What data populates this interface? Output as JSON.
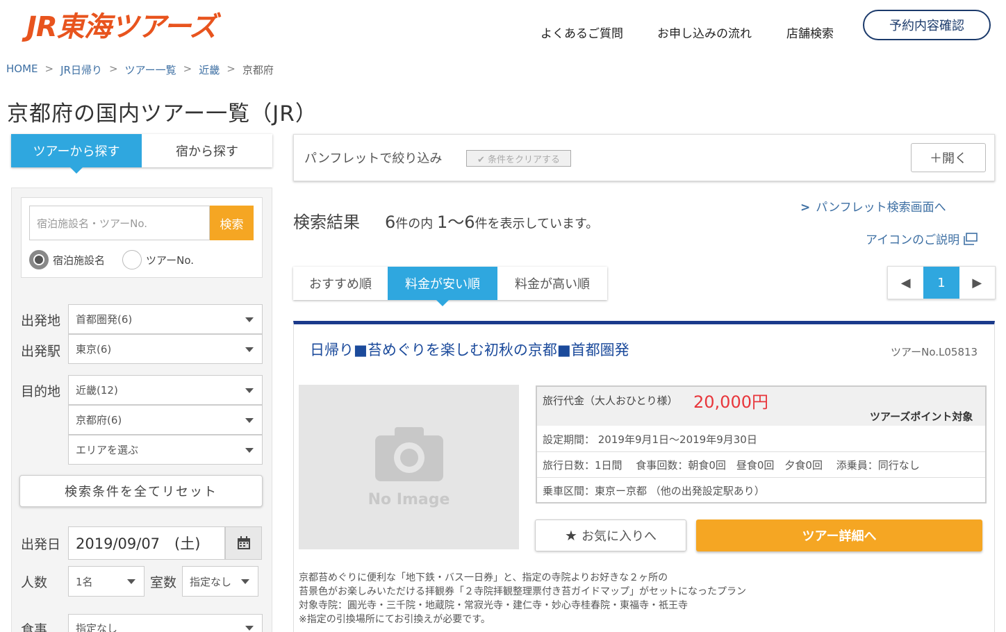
{
  "header": {
    "logo": "JR東海ツアーズ",
    "nav": [
      "よくあるご質問",
      "お申し込みの流れ",
      "店舗検索"
    ],
    "confirm_button": "予約内容確認"
  },
  "breadcrumb": [
    "HOME",
    "JR日帰り",
    "ツアー一覧",
    "近畿",
    "京都府"
  ],
  "page_title": "京都府の国内ツアー一覧（JR）",
  "left": {
    "tabs": [
      "ツアーから探す",
      "宿から探す"
    ],
    "search_placeholder": "宿泊施設名・ツアーNo.",
    "search_button": "検索",
    "radio_options": [
      "宿泊施設名",
      "ツアーNo."
    ],
    "departure_label": "出発地",
    "departure_value": "首都圏発(6)",
    "station_label": "出発駅",
    "station_value": "東京(6)",
    "destination_label": "目的地",
    "destination_region": "近畿(12)",
    "destination_pref": "京都府(6)",
    "destination_area": "エリアを選ぶ",
    "reset_button": "検索条件を全てリセット",
    "date_label": "出発日",
    "date_value": "2019/09/07　(土)",
    "people_label": "人数",
    "people_value": "1名",
    "rooms_label": "室数",
    "rooms_value": "指定なし",
    "meal_label": "食事",
    "meal_value": "指定なし"
  },
  "main": {
    "pamphlet_filter_label": "パンフレットで絞り込み",
    "clear_button": "✔ 条件をクリアする",
    "open_button": "＋開く",
    "result_label": "検索結果",
    "result_total": "6",
    "result_text1": "件の内 ",
    "result_range": "1〜6",
    "result_text2": "件を表示しています。",
    "pamphlet_link": "パンフレット検索画面へ",
    "icon_help": "アイコンのご説明",
    "sort_tabs": [
      "おすすめ順",
      "料金が安い順",
      "料金が高い順"
    ],
    "pager_current": "1"
  },
  "tour": {
    "title": "日帰り■苔めぐりを楽しむ初秋の京都■首都圏発",
    "tour_no": "ツアーNo.L05813",
    "no_image": "No Image",
    "price_label": "旅行代金（大人おひとり様）",
    "price": "20,000円",
    "points": "ツアーズポイント対象",
    "period": "設定期間：  2019年9月1日〜2019年9月30日",
    "days": "旅行日数：1日間　 食事回数：朝食0回　昼食0回　夕食0回　 添乗員：同行なし",
    "route": "乗車区間：東京ー京都  （他の出発設定駅あり）",
    "fav_button": "お気に入りへ",
    "detail_button": "ツアー詳細へ",
    "description": [
      "京都苔めぐりに便利な「地下鉄・バス一日券」と、指定の寺院よりお好きな２ヶ所の",
      "苔景色がお楽しみいただける拝観券「２寺院拝観整理票付き苔ガイドマップ」がセットになったプラン",
      "対象寺院：圓光寺・三千院・地蔵院・常寂光寺・建仁寺・妙心寺桂春院・東福寺・祇王寺",
      "※指定の引換場所にてお引換えが必要です。"
    ]
  }
}
